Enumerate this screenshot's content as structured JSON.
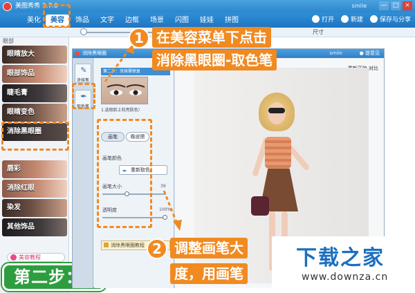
{
  "app": {
    "title": "美图秀秀 3.7.0",
    "user": "smile",
    "window_buttons": [
      "—",
      "□",
      "×"
    ]
  },
  "tabs": [
    {
      "label": "美化"
    },
    {
      "label": "美容"
    },
    {
      "label": "饰品"
    },
    {
      "label": "文字"
    },
    {
      "label": "边框"
    },
    {
      "label": "场景"
    },
    {
      "label": "闪图"
    },
    {
      "label": "娃娃"
    },
    {
      "label": "拼图"
    }
  ],
  "tab_actions": {
    "open": "打开",
    "new": "新建",
    "save_share": "保存与分享"
  },
  "toolbar": {
    "size_label": "尺寸"
  },
  "sidebar": {
    "header": "眼部",
    "items": [
      {
        "label": "眼睛放大"
      },
      {
        "label": "眼部饰品"
      },
      {
        "label": "睫毛膏"
      },
      {
        "label": "眼睛变色"
      },
      {
        "label": "消除黑眼圈"
      },
      {
        "label": "唇彩"
      },
      {
        "label": "消除红眼"
      },
      {
        "label": "染发"
      },
      {
        "label": "其他饰品"
      }
    ],
    "tip": "美容教程"
  },
  "step_badge": "第二步：",
  "dialog": {
    "title": "消除黑眼圈",
    "user": "smile",
    "help": "● 提意见",
    "tools": [
      {
        "label": "涂抹笔",
        "glyph": "✎"
      },
      {
        "label": "取色笔",
        "glyph": "✒"
      }
    ],
    "step_tag": "第二步：涂抹需修复",
    "eye_note": "1.选取脸上较亮肤色）",
    "pen_tabs": [
      "画笔",
      "橡皮擦"
    ],
    "pen_color_label": "画笔颜色",
    "recolor_label": "重新取色",
    "brush_size_label": "画笔大小",
    "brush_size_value": "39",
    "opacity_label": "透明度",
    "opacity_value": "100%",
    "tutorial_label": "消除黑眼圈教程",
    "canvas_actions": {
      "restart": "重新开始",
      "compare": "对比"
    }
  },
  "callouts": {
    "step1": {
      "number": "1",
      "line1": "在美容菜单下点击",
      "line2": "消除黑眼圈-取色笔"
    },
    "step2": {
      "number": "2",
      "line1": "调整画笔大",
      "line2": "度，用画笔"
    }
  },
  "watermark": {
    "title": "下载之家",
    "url": "www.downza.cn"
  },
  "colors": {
    "accent": "#f08a21",
    "brand_blue": "#2f8fd8",
    "step_green": "#2d9e3f"
  }
}
